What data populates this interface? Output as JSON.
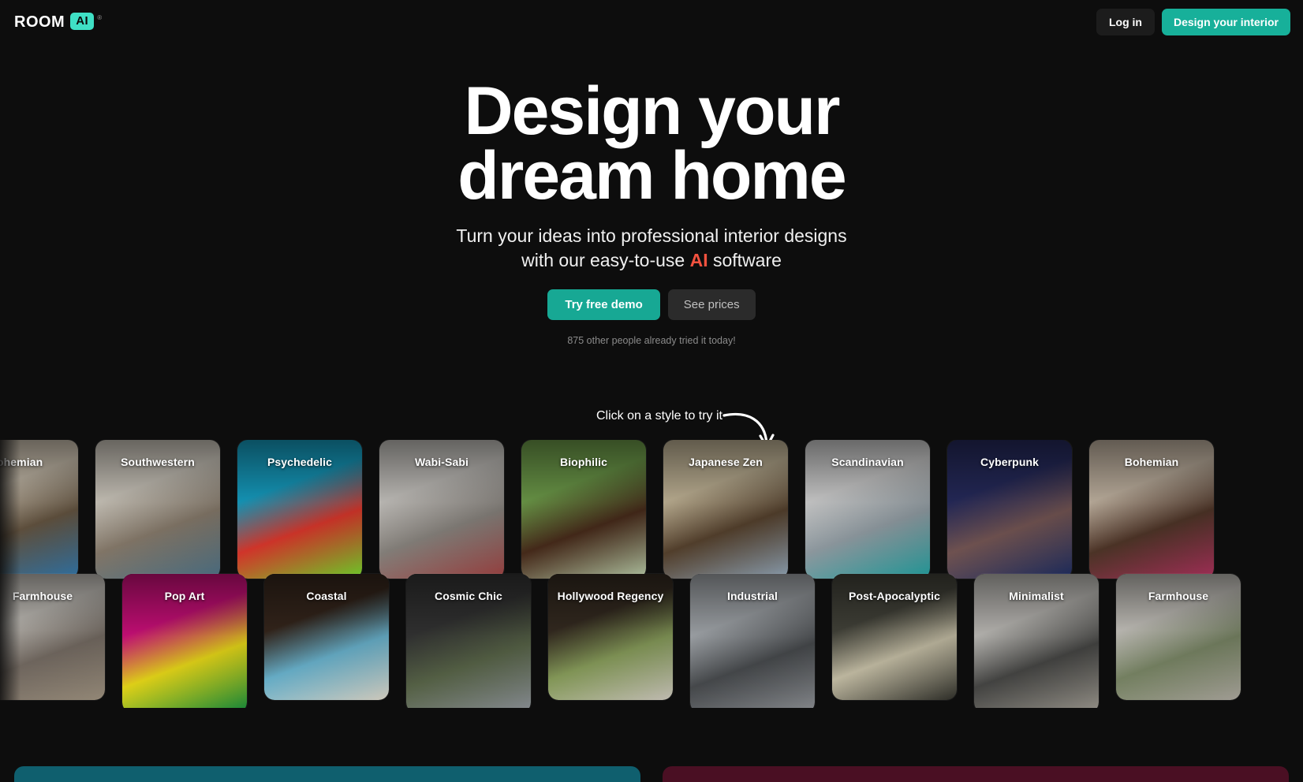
{
  "brand": {
    "word": "ROOM",
    "badge": "AI",
    "trademark": "®"
  },
  "header": {
    "login_label": "Log in",
    "cta_label": "Design your interior"
  },
  "hero": {
    "title_line1": "Design your",
    "title_line2": "dream home",
    "sub_part1": "Turn your ideas into professional interior designs with our easy-to-use ",
    "sub_accent": "AI",
    "sub_part2": " software",
    "primary_button": "Try free demo",
    "secondary_button": "See prices",
    "social_proof": "875 other people already tried it today!",
    "accent_color": "#f4523f",
    "brand_color": "#17a894"
  },
  "styles_section": {
    "hint": "Click on a style to try it",
    "row1": [
      {
        "label": "Bohemian",
        "c1": "#e8dcc8",
        "c2": "#6b5a45",
        "c3": "#2f74a8"
      },
      {
        "label": "Southwestern",
        "c1": "#e6e0d4",
        "c2": "#8e8171",
        "c3": "#4a6f84"
      },
      {
        "label": "Psychedelic",
        "c1": "#18b0d8",
        "c2": "#e63a2e",
        "c3": "#6fd52a"
      },
      {
        "label": "Wabi-Sabi",
        "c1": "#dedbd6",
        "c2": "#8f8a84",
        "c3": "#9c3f3f"
      },
      {
        "label": "Biophilic",
        "c1": "#7aad52",
        "c2": "#4b2d1c",
        "c3": "#b6c9a6"
      },
      {
        "label": "Japanese Zen",
        "c1": "#d8c9a8",
        "c2": "#5a4530",
        "c3": "#8fa3b5"
      },
      {
        "label": "Scandinavian",
        "c1": "#e9e9e9",
        "c2": "#9aa6ad",
        "c3": "#1f9c9c"
      },
      {
        "label": "Cyberpunk",
        "c1": "#2a2f66",
        "c2": "#7a5a58",
        "c3": "#1a2a5e"
      },
      {
        "label": "Bohemian",
        "c1": "#d9c9b5",
        "c2": "#53382a",
        "c3": "#a8305a"
      }
    ],
    "row2": [
      {
        "label": "Farmhouse",
        "c1": "#dedad3",
        "c2": "#7c7269",
        "c3": "#9a8e7c"
      },
      {
        "label": "Pop Art",
        "c1": "#e8118b",
        "c2": "#f5e51a",
        "c3": "#0f8a3c"
      },
      {
        "label": "Coastal",
        "c1": "#3b2a1f",
        "c2": "#6fbcd8",
        "c3": "#d8d2c4"
      },
      {
        "label": "Cosmic Chic",
        "c1": "#3a3a3a",
        "c2": "#5d6a4c",
        "c3": "#8d9299"
      },
      {
        "label": "Hollywood Regency",
        "c1": "#3a2f24",
        "c2": "#8ea45f",
        "c3": "#c9c4ba"
      },
      {
        "label": "Industrial",
        "c1": "#b9bec3",
        "c2": "#4c4f52",
        "c3": "#8c8f93"
      },
      {
        "label": "Post-Apocalyptic",
        "c1": "#4a4a40",
        "c2": "#cfc8ae",
        "c3": "#2e2e28"
      },
      {
        "label": "Minimalist",
        "c1": "#d7d5d0",
        "c2": "#4a4a48",
        "c3": "#9b978e"
      },
      {
        "label": "Farmhouse",
        "c1": "#dcd9d2",
        "c2": "#7f8c6a",
        "c3": "#a8a49b"
      }
    ]
  },
  "bottom_panels": {
    "left_color": "#0f5f6e",
    "right_color": "#4a0f23"
  }
}
